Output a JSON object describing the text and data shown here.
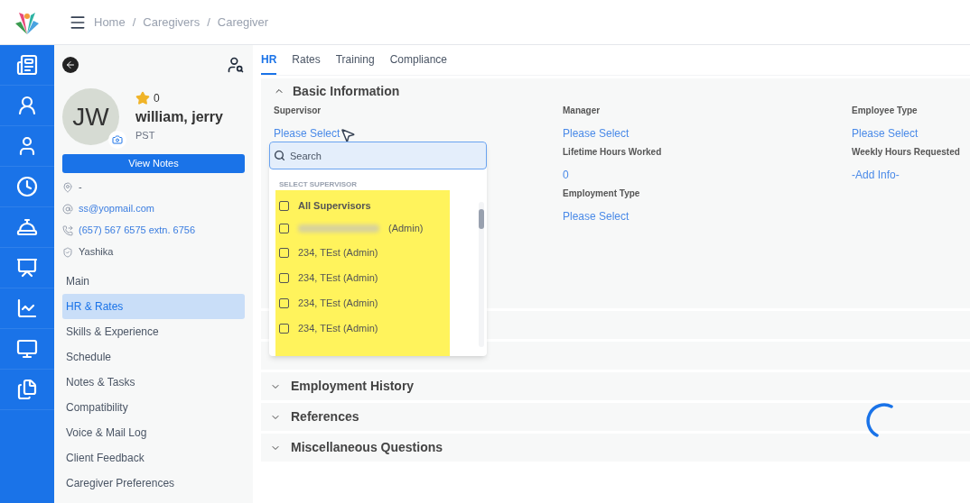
{
  "header": {
    "breadcrumbs": [
      "Home",
      "Caregivers",
      "Caregiver"
    ],
    "separator": "/"
  },
  "profile": {
    "initials": "JW",
    "rating": "0",
    "name": "william, jerry",
    "timezone": "PST",
    "view_notes": "View Notes",
    "contacts": [
      {
        "kind": "location",
        "text": "-",
        "link": false
      },
      {
        "kind": "email",
        "text": "ss@yopmail.com",
        "link": true
      },
      {
        "kind": "phone",
        "text": "(657) 567 6575 extn. 6756",
        "link": true
      },
      {
        "kind": "person",
        "text": "Yashika",
        "link": false
      }
    ]
  },
  "nav": [
    {
      "label": "Main",
      "selected": false
    },
    {
      "label": "HR & Rates",
      "selected": true
    },
    {
      "label": "Skills & Experience",
      "selected": false
    },
    {
      "label": "Schedule",
      "selected": false
    },
    {
      "label": "Notes & Tasks",
      "selected": false
    },
    {
      "label": "Compatibility",
      "selected": false
    },
    {
      "label": "Voice & Mail Log",
      "selected": false
    },
    {
      "label": "Client Feedback",
      "selected": false
    },
    {
      "label": "Caregiver Preferences",
      "selected": false
    }
  ],
  "tabs": [
    {
      "label": "HR",
      "selected": true
    },
    {
      "label": "Rates",
      "selected": false
    },
    {
      "label": "Training",
      "selected": false
    },
    {
      "label": "Compliance",
      "selected": false
    }
  ],
  "basic_information": {
    "title": "Basic Information",
    "expanded": true,
    "columns": [
      [
        {
          "label": "Supervisor",
          "value": "Please Select"
        }
      ],
      [
        {
          "label": "Manager",
          "value": "Please Select"
        },
        {
          "label": "Lifetime Hours Worked",
          "value": "0"
        },
        {
          "label": "Employment Type",
          "value": "Please Select"
        }
      ],
      [
        {
          "label": "Employee Type",
          "value": "Please Select"
        },
        {
          "label": "Weekly Hours Requested",
          "value": "-Add Info-"
        }
      ]
    ]
  },
  "sections": [
    {
      "expanded": false
    },
    {
      "expanded": false
    },
    {
      "title": "Employment History",
      "expanded": false
    },
    {
      "title": "References",
      "expanded": false
    },
    {
      "title": "Miscellaneous Questions",
      "expanded": false
    }
  ],
  "dropdown": {
    "search_placeholder": "Search",
    "heading": "SELECT SUPERVISOR",
    "highlighted": true,
    "options": [
      {
        "label": "All Supervisors",
        "checked": false,
        "kind": "all"
      },
      {
        "label": "(Admin)",
        "checked": false,
        "kind": "redacted"
      },
      {
        "label": "234, TEst (Admin)",
        "checked": false,
        "kind": "person"
      },
      {
        "label": "234, TEst (Admin)",
        "checked": false,
        "kind": "person"
      },
      {
        "label": "234, TEst (Admin)",
        "checked": false,
        "kind": "person"
      },
      {
        "label": "234, TEst (Admin)",
        "checked": false,
        "kind": "person"
      }
    ]
  },
  "loading": true
}
